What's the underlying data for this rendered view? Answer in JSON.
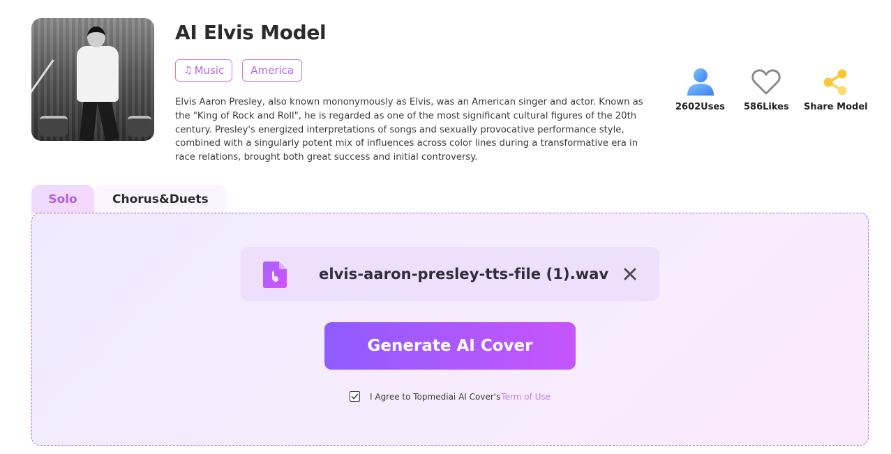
{
  "model": {
    "title": "AI Elvis Model",
    "cover_alt": "Elvis Presley performing on stage",
    "tags": [
      {
        "label": "Music",
        "icon": "music-note-icon"
      },
      {
        "label": "America"
      }
    ],
    "description": "Elvis Aaron Presley, also known mononymously as Elvis, was an American singer and actor. Known as the \"King of Rock and Roll\", he is regarded as one of the most significant cultural figures of the 20th century. Presley's energized interpretations of songs and sexually provocative performance style, combined with a singularly potent mix of influences across color lines during a transformative era in race relations, brought both great success and initial controversy."
  },
  "stats": {
    "uses": "2602Uses",
    "likes": "586Likes",
    "share": "Share Model"
  },
  "tabs": [
    {
      "label": "Solo",
      "active": true
    },
    {
      "label": "Chorus&Duets",
      "active": false
    }
  ],
  "upload": {
    "file_name": "elvis-aaron-presley-tts-file (1).wav"
  },
  "actions": {
    "generate_label": "Generate AI Cover",
    "agree_text": "I Agree to Topmediai AI Cover's",
    "term_link": "Term of Use",
    "agree_checked": true
  },
  "colors": {
    "accent": "#b465e6",
    "button_start": "#8f5cff",
    "button_end": "#c655fb",
    "share": "#f8c93a",
    "user": "#3f8bf5"
  }
}
